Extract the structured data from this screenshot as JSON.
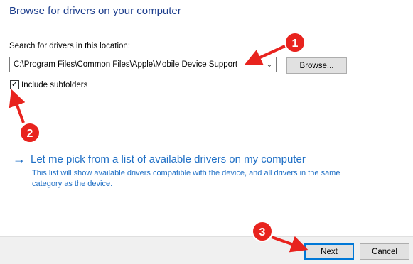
{
  "dialog": {
    "title": "Browse for drivers on your computer"
  },
  "search": {
    "label": "Search for drivers in this location:",
    "path_value": "C:\\Program Files\\Common Files\\Apple\\Mobile Device Support",
    "browse_label": "Browse..."
  },
  "subfolders": {
    "checked": true,
    "check_glyph": "✓",
    "label": "Include subfolders"
  },
  "pick": {
    "arrow_glyph": "→",
    "link_text": "Let me pick from a list of available drivers on my computer",
    "description": "This list will show available drivers compatible with the device, and all drivers in the same category as the device."
  },
  "footer": {
    "next_label": "Next",
    "cancel_label": "Cancel"
  },
  "annotations": {
    "color": "#e8231e",
    "markers": [
      "1",
      "2",
      "3"
    ]
  },
  "colors": {
    "title": "#1c3d8c",
    "link": "#1f6fc5",
    "default_button_border": "#0078d7"
  }
}
